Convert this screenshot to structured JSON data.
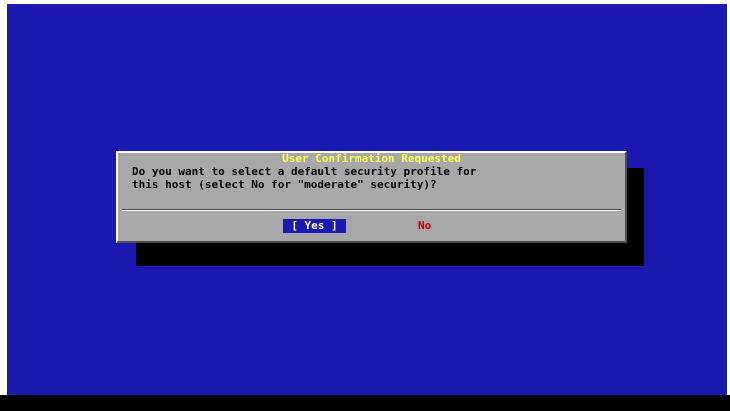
{
  "dialog": {
    "title": "User Confirmation Requested",
    "message_lines": [
      "Do you want to select a default security profile for",
      "this host (select No for \"moderate\" security)?"
    ],
    "buttons": {
      "yes_label": "[ Yes ]",
      "no_label": "No"
    }
  },
  "colors": {
    "screen_background": "#1a1ab0",
    "dialog_background": "#a8a8a8",
    "title_text": "#ffff55",
    "selected_button_bg": "#1a1ab0",
    "no_button_text": "#c00000"
  }
}
